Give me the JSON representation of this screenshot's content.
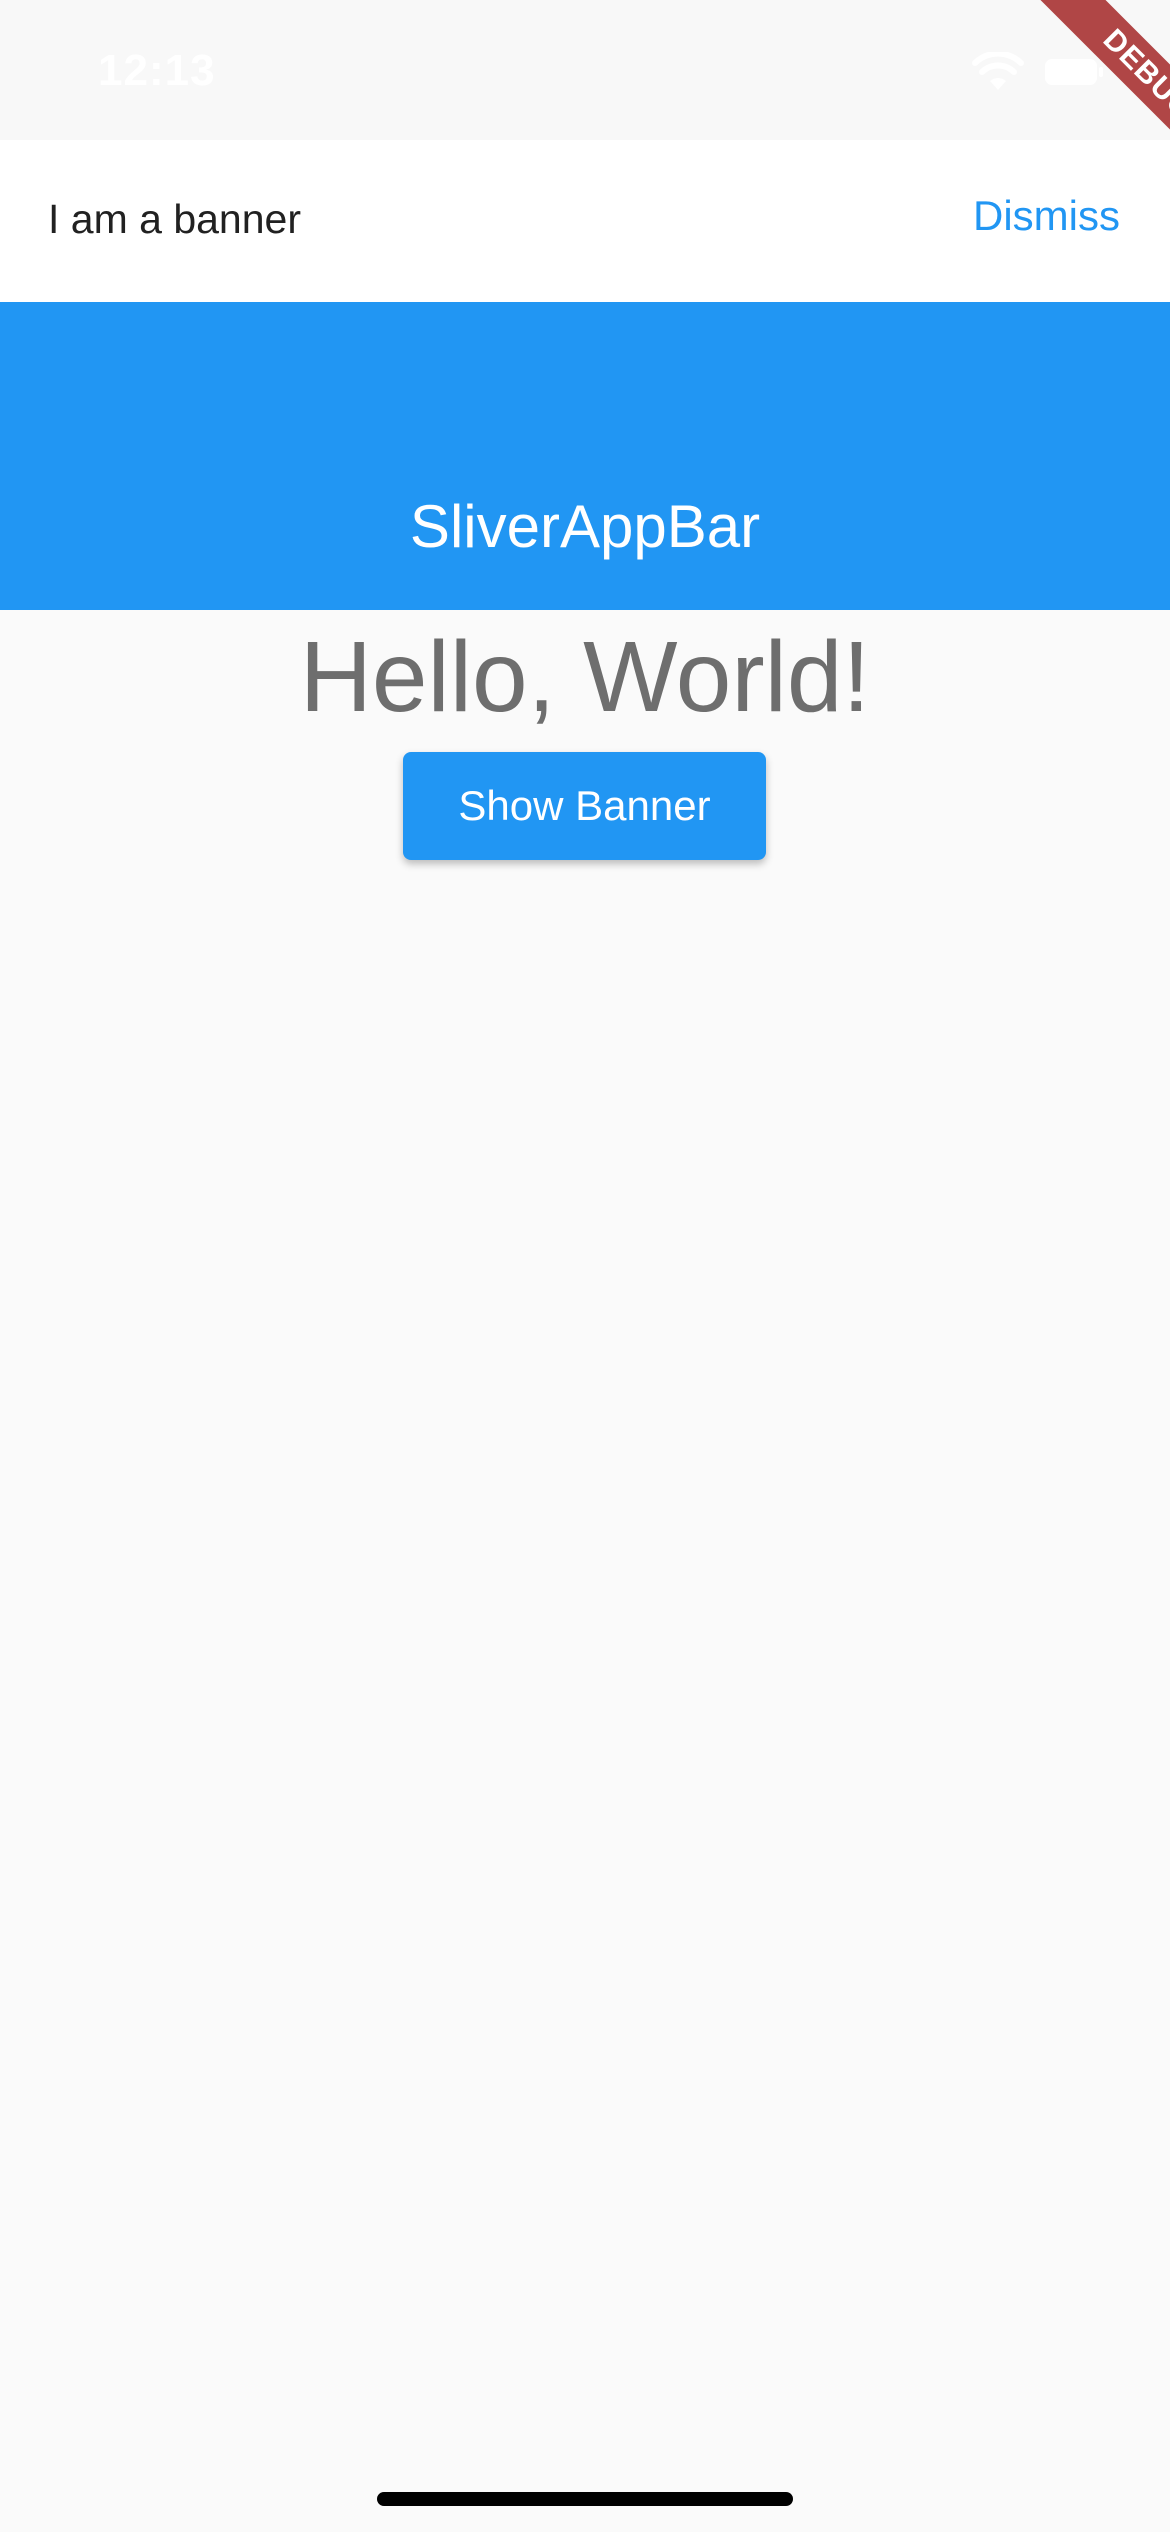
{
  "status_bar": {
    "time": "12:13",
    "wifi_icon": "wifi-icon",
    "battery_icon": "battery-icon"
  },
  "banner": {
    "message": "I am a banner",
    "dismiss_label": "Dismiss"
  },
  "app_bar": {
    "title": "SliverAppBar",
    "color": "#2196f3"
  },
  "main": {
    "greeting": "Hello, World!",
    "show_banner_label": "Show Banner"
  },
  "debug_ribbon": {
    "label": "DEBUG"
  }
}
